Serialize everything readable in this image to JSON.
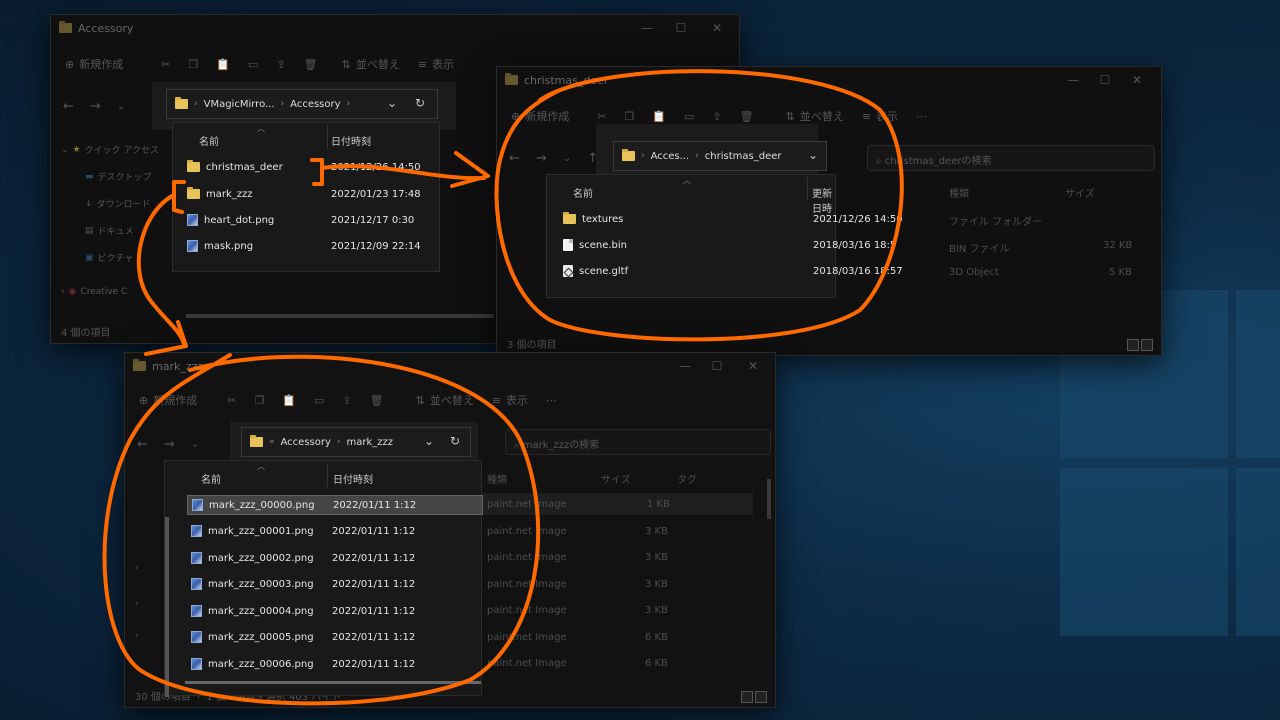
{
  "colors": {
    "accent_orange": "#ff6a00",
    "folder_yellow": "#e8c35a",
    "selection": "#444444"
  },
  "window_accessory": {
    "title": "Accessory",
    "toolbar": {
      "new_label": "新規作成",
      "sort_label": "並べ替え",
      "view_label": "表示"
    },
    "sidebar": {
      "quick_access": "クイック アクセス",
      "desktop": "デスクトップ",
      "downloads": "ダウンロード",
      "documents": "ドキュメ",
      "pictures": "ピクチャ",
      "creative_cloud": "Creative C"
    },
    "status": "4 個の項目",
    "address": {
      "part1": "VMagicMirro...",
      "part2": "Accessory"
    },
    "columns": {
      "name": "名前",
      "date": "日付時刻"
    },
    "files": [
      {
        "name": "christmas_deer",
        "date": "2021/12/26 14:50",
        "icon": "folder-icon"
      },
      {
        "name": "mark_zzz",
        "date": "2022/01/23 17:48",
        "icon": "folder-icon"
      },
      {
        "name": "heart_dot.png",
        "date": "2021/12/17 0:30",
        "icon": "png-file-icon"
      },
      {
        "name": "mask.png",
        "date": "2021/12/09 22:14",
        "icon": "png-file-icon"
      }
    ]
  },
  "window_christmas": {
    "title": "christmas_deer",
    "toolbar": {
      "new_label": "新規作成",
      "sort_label": "並べ替え",
      "view_label": "表示"
    },
    "search_placeholder": "christmas_deerの検索",
    "status": "3 個の項目",
    "address": {
      "part1": "Acces...",
      "part2": "christmas_deer"
    },
    "columns": {
      "name": "名前",
      "date": "更新日時",
      "type": "種類",
      "size": "サイズ"
    },
    "files": [
      {
        "name": "textures",
        "date": "2021/12/26 14:50",
        "type": "ファイル フォルダー",
        "size": "",
        "icon": "folder-icon"
      },
      {
        "name": "scene.bin",
        "date": "2018/03/16 18:5",
        "type": "BIN ファイル",
        "size": "32 KB",
        "icon": "bin-file-icon"
      },
      {
        "name": "scene.gltf",
        "date": "2018/03/16 18:57",
        "type": "3D Object",
        "size": "5 KB",
        "icon": "gltf-file-icon"
      }
    ]
  },
  "window_mark": {
    "title": "mark_zzz",
    "toolbar": {
      "new_label": "新規作成",
      "sort_label": "並べ替え",
      "view_label": "表示"
    },
    "search_placeholder": "mark_zzzの検索",
    "status": "30 個の項目",
    "status_selected": "1 個の項目を選択 403 バイト",
    "address": {
      "part1": "Accessory",
      "part2": "mark_zzz"
    },
    "columns": {
      "name": "名前",
      "date": "日付時刻",
      "type": "種類",
      "size": "サイズ",
      "tag": "タグ"
    },
    "files": [
      {
        "name": "mark_zzz_00000.png",
        "date": "2022/01/11 1:12",
        "type": "paint.net Image",
        "size": "1 KB",
        "selected": true
      },
      {
        "name": "mark_zzz_00001.png",
        "date": "2022/01/11 1:12",
        "type": "paint.net Image",
        "size": "3 KB"
      },
      {
        "name": "mark_zzz_00002.png",
        "date": "2022/01/11 1:12",
        "type": "paint.net Image",
        "size": "3 KB"
      },
      {
        "name": "mark_zzz_00003.png",
        "date": "2022/01/11 1:12",
        "type": "paint.net Image",
        "size": "3 KB"
      },
      {
        "name": "mark_zzz_00004.png",
        "date": "2022/01/11 1:12",
        "type": "paint.net Image",
        "size": "3 KB"
      },
      {
        "name": "mark_zzz_00005.png",
        "date": "2022/01/11 1:12",
        "type": "paint.net Image",
        "size": "6 KB"
      },
      {
        "name": "mark_zzz_00006.png",
        "date": "2022/01/11 1:12",
        "type": "paint.net Image",
        "size": "6 KB"
      }
    ]
  }
}
